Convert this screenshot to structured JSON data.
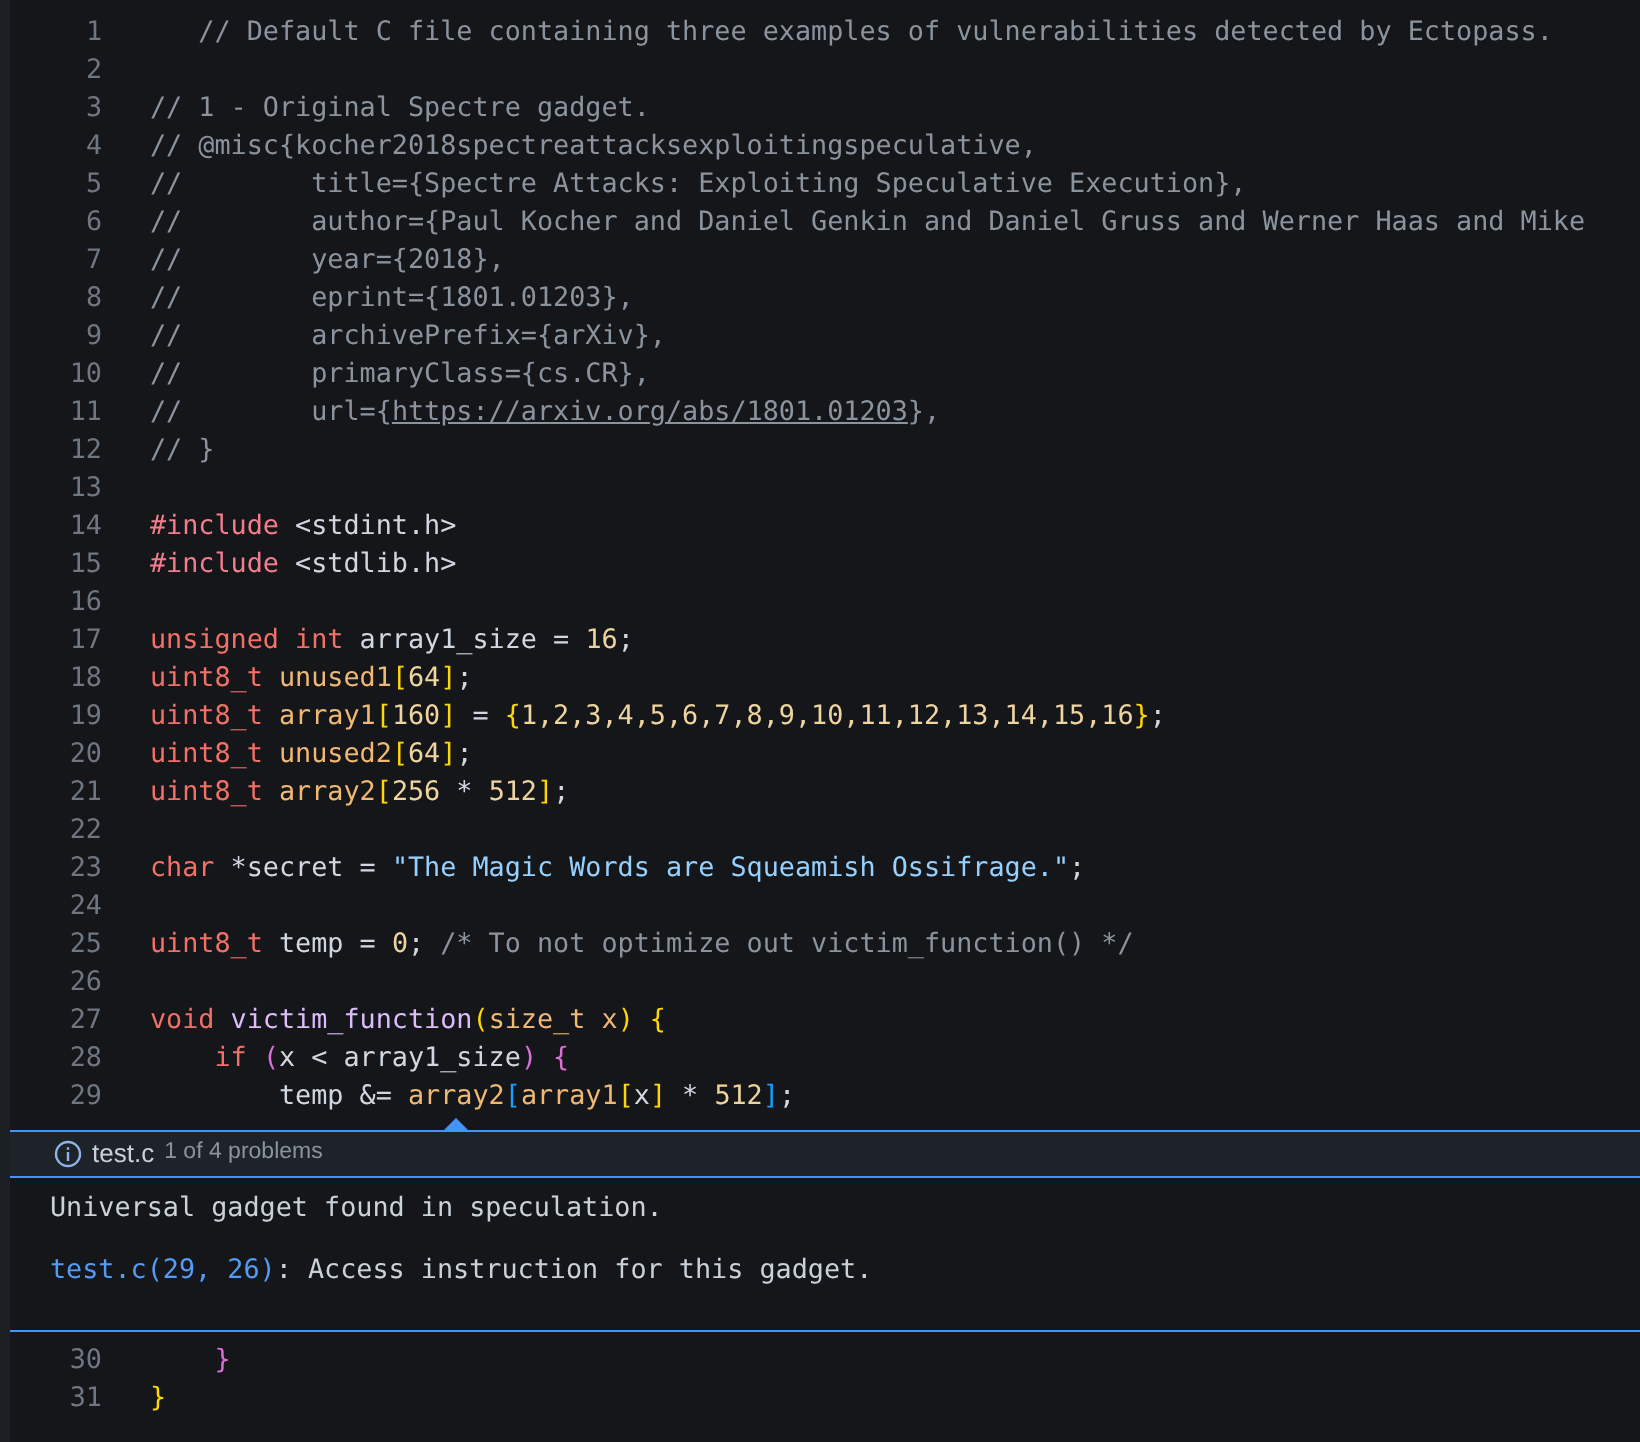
{
  "editor": {
    "lines": [
      {
        "number": "1",
        "tokens": [
          {
            "kind": "comment",
            "text": "   // Default C file containing three examples of vulnerabilities detected by Ectopass."
          }
        ]
      },
      {
        "number": "2"
      },
      {
        "number": "3",
        "tokens": [
          {
            "kind": "comment",
            "text": "// 1 - Original Spectre gadget."
          }
        ]
      },
      {
        "number": "4",
        "tokens": [
          {
            "kind": "comment",
            "text": "// @misc{kocher2018spectreattacksexploitingspeculative,"
          }
        ]
      },
      {
        "number": "5",
        "tokens": [
          {
            "kind": "comment",
            "text": "//        title={Spectre Attacks: Exploiting Speculative Execution},"
          }
        ]
      },
      {
        "number": "6",
        "tokens": [
          {
            "kind": "comment",
            "text": "//        author={Paul Kocher and Daniel Genkin and Daniel Gruss and Werner Haas and Mike"
          }
        ]
      },
      {
        "number": "7",
        "tokens": [
          {
            "kind": "comment",
            "text": "//        year={2018},"
          }
        ]
      },
      {
        "number": "8",
        "tokens": [
          {
            "kind": "comment",
            "text": "//        eprint={1801.01203},"
          }
        ]
      },
      {
        "number": "9",
        "tokens": [
          {
            "kind": "comment",
            "text": "//        archivePrefix={arXiv},"
          }
        ]
      },
      {
        "number": "10",
        "tokens": [
          {
            "kind": "comment",
            "text": "//        primaryClass={cs.CR},"
          }
        ]
      },
      {
        "number": "11",
        "tokens": [
          {
            "kind": "comment",
            "text": "//        url={"
          },
          {
            "kind": "link",
            "text": "https://arxiv.org/abs/1801.01203"
          },
          {
            "kind": "comment",
            "text": "},"
          }
        ]
      },
      {
        "number": "12",
        "tokens": [
          {
            "kind": "comment",
            "text": "// }"
          }
        ]
      },
      {
        "number": "13"
      },
      {
        "number": "14",
        "tokens": [
          {
            "kind": "directive",
            "text": "#include"
          },
          {
            "kind": "plain",
            "text": " <stdint.h>"
          }
        ]
      },
      {
        "number": "15",
        "tokens": [
          {
            "kind": "directive",
            "text": "#include"
          },
          {
            "kind": "plain",
            "text": " <stdlib.h>"
          }
        ]
      },
      {
        "number": "16"
      },
      {
        "number": "17",
        "tokens": [
          {
            "kind": "keyword",
            "text": "unsigned int"
          },
          {
            "kind": "plain",
            "text": " array1_size = "
          },
          {
            "kind": "number",
            "text": "16"
          },
          {
            "kind": "plain",
            "text": ";"
          }
        ]
      },
      {
        "number": "18",
        "tokens": [
          {
            "kind": "keyword",
            "text": "uint8_t"
          },
          {
            "kind": "variable",
            "text": " unused1"
          },
          {
            "kind": "bracket1",
            "text": "["
          },
          {
            "kind": "number",
            "text": "64"
          },
          {
            "kind": "bracket1",
            "text": "]"
          },
          {
            "kind": "plain",
            "text": ";"
          }
        ]
      },
      {
        "number": "19",
        "tokens": [
          {
            "kind": "keyword",
            "text": "uint8_t"
          },
          {
            "kind": "variable",
            "text": " array1"
          },
          {
            "kind": "bracket1",
            "text": "["
          },
          {
            "kind": "number",
            "text": "160"
          },
          {
            "kind": "bracket1",
            "text": "]"
          },
          {
            "kind": "plain",
            "text": " = "
          },
          {
            "kind": "bracket1",
            "text": "{"
          },
          {
            "kind": "number",
            "text": "1,2,3,4,5,6,7,8,9,10,11,12,13,14,15,16"
          },
          {
            "kind": "bracket1",
            "text": "}"
          },
          {
            "kind": "plain",
            "text": ";"
          }
        ]
      },
      {
        "number": "20",
        "tokens": [
          {
            "kind": "keyword",
            "text": "uint8_t"
          },
          {
            "kind": "variable",
            "text": " unused2"
          },
          {
            "kind": "bracket1",
            "text": "["
          },
          {
            "kind": "number",
            "text": "64"
          },
          {
            "kind": "bracket1",
            "text": "]"
          },
          {
            "kind": "plain",
            "text": ";"
          }
        ]
      },
      {
        "number": "21",
        "tokens": [
          {
            "kind": "keyword",
            "text": "uint8_t"
          },
          {
            "kind": "variable",
            "text": " array2"
          },
          {
            "kind": "bracket1",
            "text": "["
          },
          {
            "kind": "number",
            "text": "256"
          },
          {
            "kind": "plain",
            "text": " * "
          },
          {
            "kind": "number",
            "text": "512"
          },
          {
            "kind": "bracket1",
            "text": "]"
          },
          {
            "kind": "plain",
            "text": ";"
          }
        ]
      },
      {
        "number": "22"
      },
      {
        "number": "23",
        "tokens": [
          {
            "kind": "keyword",
            "text": "char"
          },
          {
            "kind": "plain",
            "text": " *secret = "
          },
          {
            "kind": "string",
            "text": "\"The Magic Words are Squeamish Ossifrage.\""
          },
          {
            "kind": "plain",
            "text": ";"
          }
        ]
      },
      {
        "number": "24"
      },
      {
        "number": "25",
        "tokens": [
          {
            "kind": "keyword",
            "text": "uint8_t"
          },
          {
            "kind": "plain",
            "text": " temp = "
          },
          {
            "kind": "number",
            "text": "0"
          },
          {
            "kind": "plain",
            "text": "; "
          },
          {
            "kind": "comment",
            "text": "/* To not optimize out victim_function() */"
          }
        ]
      },
      {
        "number": "26"
      },
      {
        "number": "27",
        "tokens": [
          {
            "kind": "keyword",
            "text": "void"
          },
          {
            "kind": "function",
            "text": " victim_function"
          },
          {
            "kind": "bracket1",
            "text": "("
          },
          {
            "kind": "variable",
            "text": "size_t x"
          },
          {
            "kind": "bracket1",
            "text": ") {"
          }
        ]
      },
      {
        "number": "28",
        "tokens": [
          {
            "kind": "keyword",
            "text": "    if "
          },
          {
            "kind": "bracket2",
            "text": "("
          },
          {
            "kind": "plain",
            "text": "x < array1_size"
          },
          {
            "kind": "bracket2",
            "text": ") {"
          }
        ]
      },
      {
        "number": "29",
        "tokens": [
          {
            "kind": "plain",
            "text": "        temp &= "
          },
          {
            "kind": "variable",
            "text": "array2"
          },
          {
            "kind": "bracket3",
            "text": "["
          },
          {
            "kind": "variable",
            "text": "array1"
          },
          {
            "kind": "bracket1",
            "text": "["
          },
          {
            "kind": "plain",
            "text": "x"
          },
          {
            "kind": "bracket1",
            "text": "]"
          },
          {
            "kind": "plain",
            "text": " * "
          },
          {
            "kind": "number",
            "text": "512"
          },
          {
            "kind": "bracket3",
            "text": "]"
          },
          {
            "kind": "plain",
            "text": ";"
          }
        ]
      }
    ]
  },
  "peek": {
    "file": "test.c",
    "count": "1 of 4 problems",
    "message": "Universal gadget found in speculation.",
    "location": "test.c(29, 26)",
    "detail": ": Access instruction for this gadget."
  },
  "editor_after": {
    "lines": [
      {
        "number": "30",
        "tokens": [
          {
            "kind": "bracket2",
            "text": "    }"
          }
        ]
      },
      {
        "number": "31",
        "tokens": [
          {
            "kind": "bracket1",
            "text": "}"
          }
        ]
      }
    ]
  }
}
